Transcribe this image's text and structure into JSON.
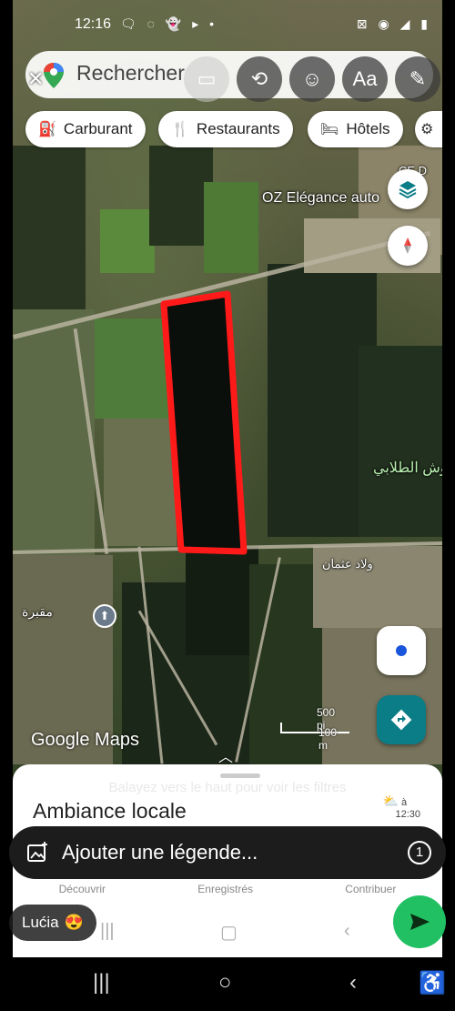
{
  "status": {
    "time": "12:16",
    "left_icons": "🗨 ◌ 👻 ▸ •",
    "right_icons": "⊠ ◉ ◢ ▮"
  },
  "search": {
    "placeholder": "Rechercher",
    "close_glyph": "✕"
  },
  "toolbar": {
    "sticker_faint_glyph": "▭",
    "crop_glyph": "⟲",
    "emoji_glyph": "☺",
    "text_glyph": "Aa",
    "draw_glyph": "✎"
  },
  "chips": [
    {
      "icon": "⛽",
      "label": "Carburant"
    },
    {
      "icon": "🍴",
      "label": "Restaurants"
    },
    {
      "icon": "🛏",
      "label": "Hôtels"
    },
    {
      "icon": "⚙",
      "label": ""
    }
  ],
  "map": {
    "labels": {
      "business": "OZ Elégance auto",
      "arabic_right": "حوش الطلابي",
      "arabic_mid": "ولاد عثمان",
      "arabic_left": "مقبرة",
      "corner": "CE D"
    },
    "logo": "Google Maps",
    "scale_top": "500 pi",
    "scale_bottom": "100 m",
    "parcel_color": "#ff1a1a",
    "directions_color": "#0b7d86",
    "location_dot_color": "#1a56db"
  },
  "sheet": {
    "hint": "Balayez vers le haut pour voir les filtres",
    "title": "Ambiance locale",
    "weather_label": "à",
    "weather_time": "12:30",
    "tabs": [
      "Découvrir",
      "Enregistrés",
      "Contribuer"
    ]
  },
  "caption": {
    "placeholder": "Ajouter une légende...",
    "count": "1"
  },
  "recipient": {
    "name": "Lućia",
    "emoji": "😍"
  },
  "send_color": "#21c063",
  "navbar": {
    "recents": "|||",
    "home": "○",
    "back": "‹",
    "accessibility": "♿"
  }
}
